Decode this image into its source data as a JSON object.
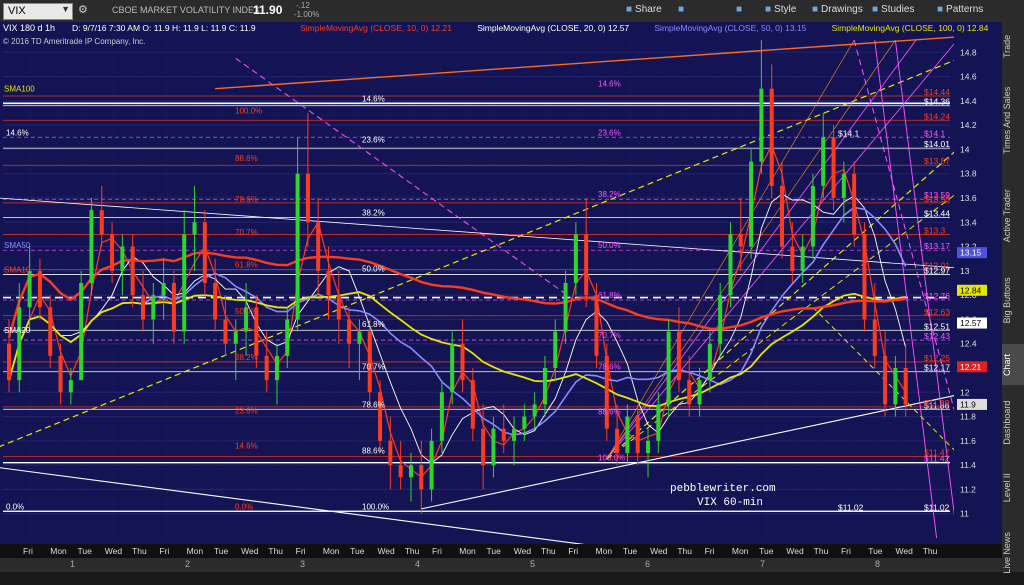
{
  "toolbar": {
    "symbol": "VIX",
    "title": "CBOE MARKET VOLATILITY INDEX",
    "last": "11.90",
    "change": "-.12",
    "change_pct": "-1.00%",
    "buttons": [
      {
        "icon": "share-icon",
        "label": "Share"
      },
      {
        "icon": "bell-icon",
        "label": ""
      },
      {
        "icon": "gear-icon",
        "label": ""
      },
      {
        "icon": "style-icon",
        "label": "Style"
      },
      {
        "icon": "drawings-icon",
        "label": "Drawings"
      },
      {
        "icon": "studies-icon",
        "label": "Studies"
      },
      {
        "icon": "patterns-icon",
        "label": "Patterns"
      }
    ]
  },
  "header": {
    "symbol_period": "VIX 180 d 1h",
    "ohlc": "D: 9/7/16 7:30 AM   O: 11.9   H: 11.9   L: 11.9   C: 11.9",
    "copyright": "© 2016 TD Ameritrade IP Company, Inc.",
    "studies": [
      {
        "text": "SimpleMovingAvg (CLOSE, 10, 0)",
        "value": "12.21",
        "color": "#ff3b1f"
      },
      {
        "text": "SimpleMovingAvg (CLOSE, 20, 0)",
        "value": "12.57",
        "color": "#ffffff"
      },
      {
        "text": "SimpleMovingAvg (CLOSE, 50, 0)",
        "value": "13.15",
        "color": "#8a8aff"
      },
      {
        "text": "SimpleMovingAvg (CLOSE, 100, 0)",
        "value": "12.84",
        "color": "#e6e600"
      }
    ]
  },
  "right_tabs": [
    "Trade",
    "Times And Sales",
    "Active Trader",
    "Big Buttons",
    "Chart",
    "Dashboard",
    "Level II",
    "Live News"
  ],
  "bottom_bar": [
    "1",
    "2",
    "3",
    "4",
    "5",
    "6",
    "7",
    "8"
  ],
  "colors": {
    "background": "#141454",
    "up": "#2fd52f",
    "down": "#ff3b1f",
    "sma10": "#ff3b1f",
    "sma20": "#ffffff",
    "sma50": "#8a8aff",
    "sma100": "#e6e600",
    "fib": "#ff55ff"
  },
  "chart_data": {
    "type": "candlestick",
    "title": "VIX 60-min",
    "source_label": "pebblewriter.com",
    "symbol": "VIX",
    "timeframe": "1h",
    "ylim": [
      10.8,
      15.0
    ],
    "y_ticks": [
      "14.8",
      "14.6",
      "14.4",
      "14.2",
      "14",
      "13.8",
      "13.6",
      "13.4",
      "13.2",
      "13",
      "12.8",
      "12.6",
      "12.4",
      "12.2",
      "12",
      "11.8",
      "11.6",
      "11.4",
      "11.2",
      "11"
    ],
    "x_labels": [
      "Fri",
      "Mon",
      "Tue",
      "Wed",
      "Thu",
      "Fri",
      "Mon",
      "Tue",
      "Wed",
      "Thu",
      "Fri",
      "Mon",
      "Tue",
      "Wed",
      "Thu",
      "Fri",
      "Mon",
      "Tue",
      "Wed",
      "Thu",
      "Fri",
      "Mon",
      "Tue",
      "Wed",
      "Thu",
      "Fri",
      "Mon",
      "Tue",
      "Wed",
      "Thu",
      "Fri",
      "Tue",
      "Wed",
      "Thu"
    ],
    "price_labels": [
      {
        "text": "$14.44",
        "value": 14.44,
        "color": "#ff3b1f"
      },
      {
        "text": "$14.36",
        "value": 14.36,
        "color": "#ffffff"
      },
      {
        "text": "$14.24",
        "value": 14.24,
        "color": "#ff3b1f"
      },
      {
        "text": "$14.1",
        "value": 14.1,
        "color": "#ff55ff"
      },
      {
        "text": "$14.01",
        "value": 14.01,
        "color": "#ffffff"
      },
      {
        "text": "$13.87",
        "value": 13.87,
        "color": "#ff3b1f"
      },
      {
        "text": "$13.59",
        "value": 13.59,
        "color": "#ff55ff"
      },
      {
        "text": "$13.56",
        "value": 13.56,
        "color": "#ff3b1f"
      },
      {
        "text": "$13.44",
        "value": 13.44,
        "color": "#ffffff"
      },
      {
        "text": "$13.3",
        "value": 13.3,
        "color": "#ff3b1f"
      },
      {
        "text": "$13.17",
        "value": 13.17,
        "color": "#ff55ff"
      },
      {
        "text": "$13.01",
        "value": 13.01,
        "color": "#ff3b1f"
      },
      {
        "text": "$12.97",
        "value": 12.97,
        "color": "#ffffff"
      },
      {
        "text": "$12.76",
        "value": 12.76,
        "color": "#ff55ff"
      },
      {
        "text": "$12.63",
        "value": 12.63,
        "color": "#ff3b1f"
      },
      {
        "text": "$12.51",
        "value": 12.51,
        "color": "#ffffff"
      },
      {
        "text": "$12.43",
        "value": 12.43,
        "color": "#ff55ff"
      },
      {
        "text": "$12.25",
        "value": 12.25,
        "color": "#ff3b1f"
      },
      {
        "text": "$12.17",
        "value": 12.17,
        "color": "#ffffff"
      },
      {
        "text": "$11.86",
        "value": 11.86,
        "color": "#ffffff"
      },
      {
        "text": "$11.88",
        "value": 11.88,
        "color": "#ff3b1f"
      },
      {
        "text": "$11.47",
        "value": 11.47,
        "color": "#ff3b1f"
      },
      {
        "text": "$11.42",
        "value": 11.42,
        "color": "#ff55ff"
      },
      {
        "text": "$11.02",
        "value": 11.02,
        "color": "#ffffff"
      }
    ],
    "tags": [
      {
        "text": "13.15",
        "value": 13.15,
        "bg": "#5050e0",
        "fg": "#ffffff"
      },
      {
        "text": "12.84",
        "value": 12.84,
        "bg": "#e6e600",
        "fg": "#000000"
      },
      {
        "text": "12.57",
        "value": 12.57,
        "bg": "#ffffff",
        "fg": "#000000"
      },
      {
        "text": "12.21",
        "value": 12.21,
        "bg": "#e02020",
        "fg": "#ffffff"
      },
      {
        "text": "11.9",
        "value": 11.9,
        "bg": "#dddddd",
        "fg": "#000000"
      }
    ],
    "fib_labels": [
      {
        "text": "14.6%",
        "value": 14.38,
        "color": "#ffffff"
      },
      {
        "text": "23.6%",
        "value": 14.04,
        "color": "#ffffff"
      },
      {
        "text": "38.2%",
        "value": 13.44,
        "color": "#ffffff"
      },
      {
        "text": "50.0%",
        "value": 12.98,
        "color": "#ffffff"
      },
      {
        "text": "61.8%",
        "value": 12.52,
        "color": "#ffffff"
      },
      {
        "text": "70.7%",
        "value": 12.17,
        "color": "#ffffff"
      },
      {
        "text": "78.6%",
        "value": 11.86,
        "color": "#ffffff"
      },
      {
        "text": "88.6%",
        "value": 11.48,
        "color": "#ffffff"
      },
      {
        "text": "100.0%",
        "value": 11.02,
        "color": "#ffffff"
      },
      {
        "text": "100.0%",
        "value": 14.28,
        "color": "#ff3b1f"
      },
      {
        "text": "88.6%",
        "value": 13.89,
        "color": "#ff3b1f"
      },
      {
        "text": "78.6%",
        "value": 13.55,
        "color": "#ff3b1f"
      },
      {
        "text": "70.7%",
        "value": 13.28,
        "color": "#ff3b1f"
      },
      {
        "text": "61.8%",
        "value": 13.01,
        "color": "#ff3b1f"
      },
      {
        "text": "50.0%",
        "value": 12.63,
        "color": "#ff3b1f"
      },
      {
        "text": "38.2%",
        "value": 12.25,
        "color": "#ff3b1f"
      },
      {
        "text": "23.6%",
        "value": 11.81,
        "color": "#ff3b1f"
      },
      {
        "text": "14.6%",
        "value": 11.52,
        "color": "#ff3b1f"
      },
      {
        "text": "0.0%",
        "value": 11.02,
        "color": "#ff3b1f"
      },
      {
        "text": "14.6%",
        "value": 14.5,
        "color": "#ff55ff"
      },
      {
        "text": "23.6%",
        "value": 14.1,
        "color": "#ff55ff"
      },
      {
        "text": "38.2%",
        "value": 13.59,
        "color": "#ff55ff"
      },
      {
        "text": "50.0%",
        "value": 13.17,
        "color": "#ff55ff"
      },
      {
        "text": "61.8%",
        "value": 12.76,
        "color": "#ff55ff"
      },
      {
        "text": "70.7%",
        "value": 12.43,
        "color": "#ff55ff"
      },
      {
        "text": "78.6%",
        "value": 12.17,
        "color": "#ff55ff"
      },
      {
        "text": "88.6%",
        "value": 11.8,
        "color": "#ff55ff"
      },
      {
        "text": "100.0%",
        "value": 11.42,
        "color": "#ff55ff"
      },
      {
        "text": "14.6%",
        "value": 14.1,
        "color": "#ffffff"
      },
      {
        "text": "0.0%",
        "value": 11.02,
        "color": "#ffffff"
      }
    ],
    "sma_labels": [
      {
        "text": "SMA100",
        "value": 14.46,
        "color": "#e6e600"
      },
      {
        "text": "SMA50",
        "value": 13.17,
        "color": "#8a8aff"
      },
      {
        "text": "SMA10",
        "value": 12.97,
        "color": "#ff3b1f"
      },
      {
        "text": "SMA20",
        "value": 12.47,
        "color": "#ffffff"
      }
    ],
    "extra_labels": [
      {
        "text": "$14.1",
        "value": 14.1,
        "color": "#ffffff"
      },
      {
        "text": "$11.02",
        "value": 11.02,
        "color": "#ffffff"
      }
    ],
    "candles": [
      [
        12.4,
        12.6,
        12.0,
        12.1
      ],
      [
        12.1,
        12.9,
        12.0,
        12.7
      ],
      [
        12.7,
        13.2,
        12.5,
        13.0
      ],
      [
        13.0,
        13.1,
        12.6,
        12.7
      ],
      [
        12.7,
        12.8,
        12.2,
        12.3
      ],
      [
        12.3,
        12.4,
        11.9,
        12.0
      ],
      [
        12.0,
        12.2,
        11.9,
        12.1
      ],
      [
        12.1,
        13.0,
        12.1,
        12.9
      ],
      [
        12.9,
        13.6,
        12.8,
        13.5
      ],
      [
        13.5,
        13.7,
        13.2,
        13.3
      ],
      [
        13.3,
        13.4,
        12.9,
        13.0
      ],
      [
        13.0,
        13.3,
        12.8,
        13.2
      ],
      [
        13.2,
        13.3,
        12.7,
        12.8
      ],
      [
        12.8,
        13.0,
        12.5,
        12.6
      ],
      [
        12.6,
        12.9,
        12.4,
        12.8
      ],
      [
        12.8,
        13.1,
        12.6,
        12.9
      ],
      [
        12.9,
        13.0,
        12.4,
        12.5
      ],
      [
        12.5,
        13.5,
        12.4,
        13.3
      ],
      [
        13.3,
        13.7,
        13.0,
        13.4
      ],
      [
        13.4,
        13.5,
        12.8,
        12.9
      ],
      [
        12.9,
        13.1,
        12.5,
        12.6
      ],
      [
        12.6,
        12.8,
        12.3,
        12.4
      ],
      [
        12.4,
        12.6,
        12.1,
        12.5
      ],
      [
        12.5,
        12.9,
        12.3,
        12.7
      ],
      [
        12.7,
        12.8,
        12.2,
        12.3
      ],
      [
        12.3,
        12.5,
        12.0,
        12.1
      ],
      [
        12.1,
        12.4,
        11.9,
        12.3
      ],
      [
        12.3,
        12.7,
        12.2,
        12.6
      ],
      [
        12.6,
        14.1,
        12.5,
        13.8
      ],
      [
        13.8,
        14.3,
        13.2,
        13.4
      ],
      [
        13.4,
        13.6,
        12.8,
        13.0
      ],
      [
        13.0,
        13.2,
        12.6,
        12.8
      ],
      [
        12.8,
        13.0,
        12.4,
        12.6
      ],
      [
        12.6,
        12.7,
        12.2,
        12.4
      ],
      [
        12.4,
        12.6,
        12.1,
        12.5
      ],
      [
        12.5,
        12.6,
        11.9,
        12.0
      ],
      [
        12.0,
        12.1,
        11.5,
        11.6
      ],
      [
        11.6,
        11.8,
        11.2,
        11.4
      ],
      [
        11.4,
        11.6,
        11.2,
        11.3
      ],
      [
        11.3,
        11.5,
        11.1,
        11.4
      ],
      [
        11.4,
        11.6,
        11.0,
        11.2
      ],
      [
        11.2,
        11.7,
        11.1,
        11.6
      ],
      [
        11.6,
        12.1,
        11.5,
        12.0
      ],
      [
        12.0,
        12.5,
        11.9,
        12.4
      ],
      [
        12.4,
        12.6,
        12.0,
        12.1
      ],
      [
        12.1,
        12.2,
        11.6,
        11.7
      ],
      [
        11.7,
        11.9,
        11.2,
        11.4
      ],
      [
        11.4,
        11.8,
        11.3,
        11.7
      ],
      [
        11.7,
        11.9,
        11.5,
        11.6
      ],
      [
        11.6,
        11.8,
        11.4,
        11.7
      ],
      [
        11.7,
        11.9,
        11.6,
        11.8
      ],
      [
        11.8,
        12.0,
        11.7,
        11.9
      ],
      [
        11.9,
        12.3,
        11.8,
        12.2
      ],
      [
        12.2,
        12.6,
        12.1,
        12.5
      ],
      [
        12.5,
        13.0,
        12.4,
        12.9
      ],
      [
        12.9,
        13.4,
        12.8,
        13.3
      ],
      [
        13.3,
        13.6,
        12.7,
        12.8
      ],
      [
        12.8,
        12.9,
        12.2,
        12.3
      ],
      [
        12.3,
        12.4,
        11.6,
        11.7
      ],
      [
        11.7,
        11.9,
        11.4,
        11.5
      ],
      [
        11.5,
        11.9,
        11.4,
        11.8
      ],
      [
        11.8,
        11.9,
        11.4,
        11.5
      ],
      [
        11.5,
        11.7,
        11.3,
        11.6
      ],
      [
        11.6,
        12.0,
        11.5,
        11.9
      ],
      [
        11.9,
        12.6,
        11.8,
        12.5
      ],
      [
        12.5,
        12.7,
        12.0,
        12.1
      ],
      [
        12.1,
        12.3,
        11.8,
        11.9
      ],
      [
        11.9,
        12.2,
        11.8,
        12.1
      ],
      [
        12.1,
        12.5,
        12.0,
        12.4
      ],
      [
        12.4,
        12.9,
        12.3,
        12.8
      ],
      [
        12.8,
        13.4,
        12.7,
        13.3
      ],
      [
        13.3,
        13.6,
        13.0,
        13.2
      ],
      [
        13.2,
        14.0,
        13.1,
        13.9
      ],
      [
        13.9,
        14.9,
        13.8,
        14.5
      ],
      [
        14.5,
        14.7,
        13.6,
        13.7
      ],
      [
        13.7,
        13.9,
        13.1,
        13.2
      ],
      [
        13.2,
        13.4,
        12.9,
        13.0
      ],
      [
        13.0,
        13.3,
        12.9,
        13.2
      ],
      [
        13.2,
        13.8,
        13.1,
        13.7
      ],
      [
        13.7,
        14.3,
        13.6,
        14.1
      ],
      [
        14.1,
        14.2,
        13.5,
        13.6
      ],
      [
        13.6,
        13.9,
        13.4,
        13.8
      ],
      [
        13.8,
        13.9,
        13.2,
        13.3
      ],
      [
        13.3,
        13.4,
        12.5,
        12.6
      ],
      [
        12.6,
        12.9,
        12.2,
        12.3
      ],
      [
        12.3,
        12.5,
        11.8,
        11.9
      ],
      [
        11.9,
        12.3,
        11.8,
        12.2
      ],
      [
        12.2,
        12.4,
        11.8,
        11.9
      ]
    ]
  }
}
